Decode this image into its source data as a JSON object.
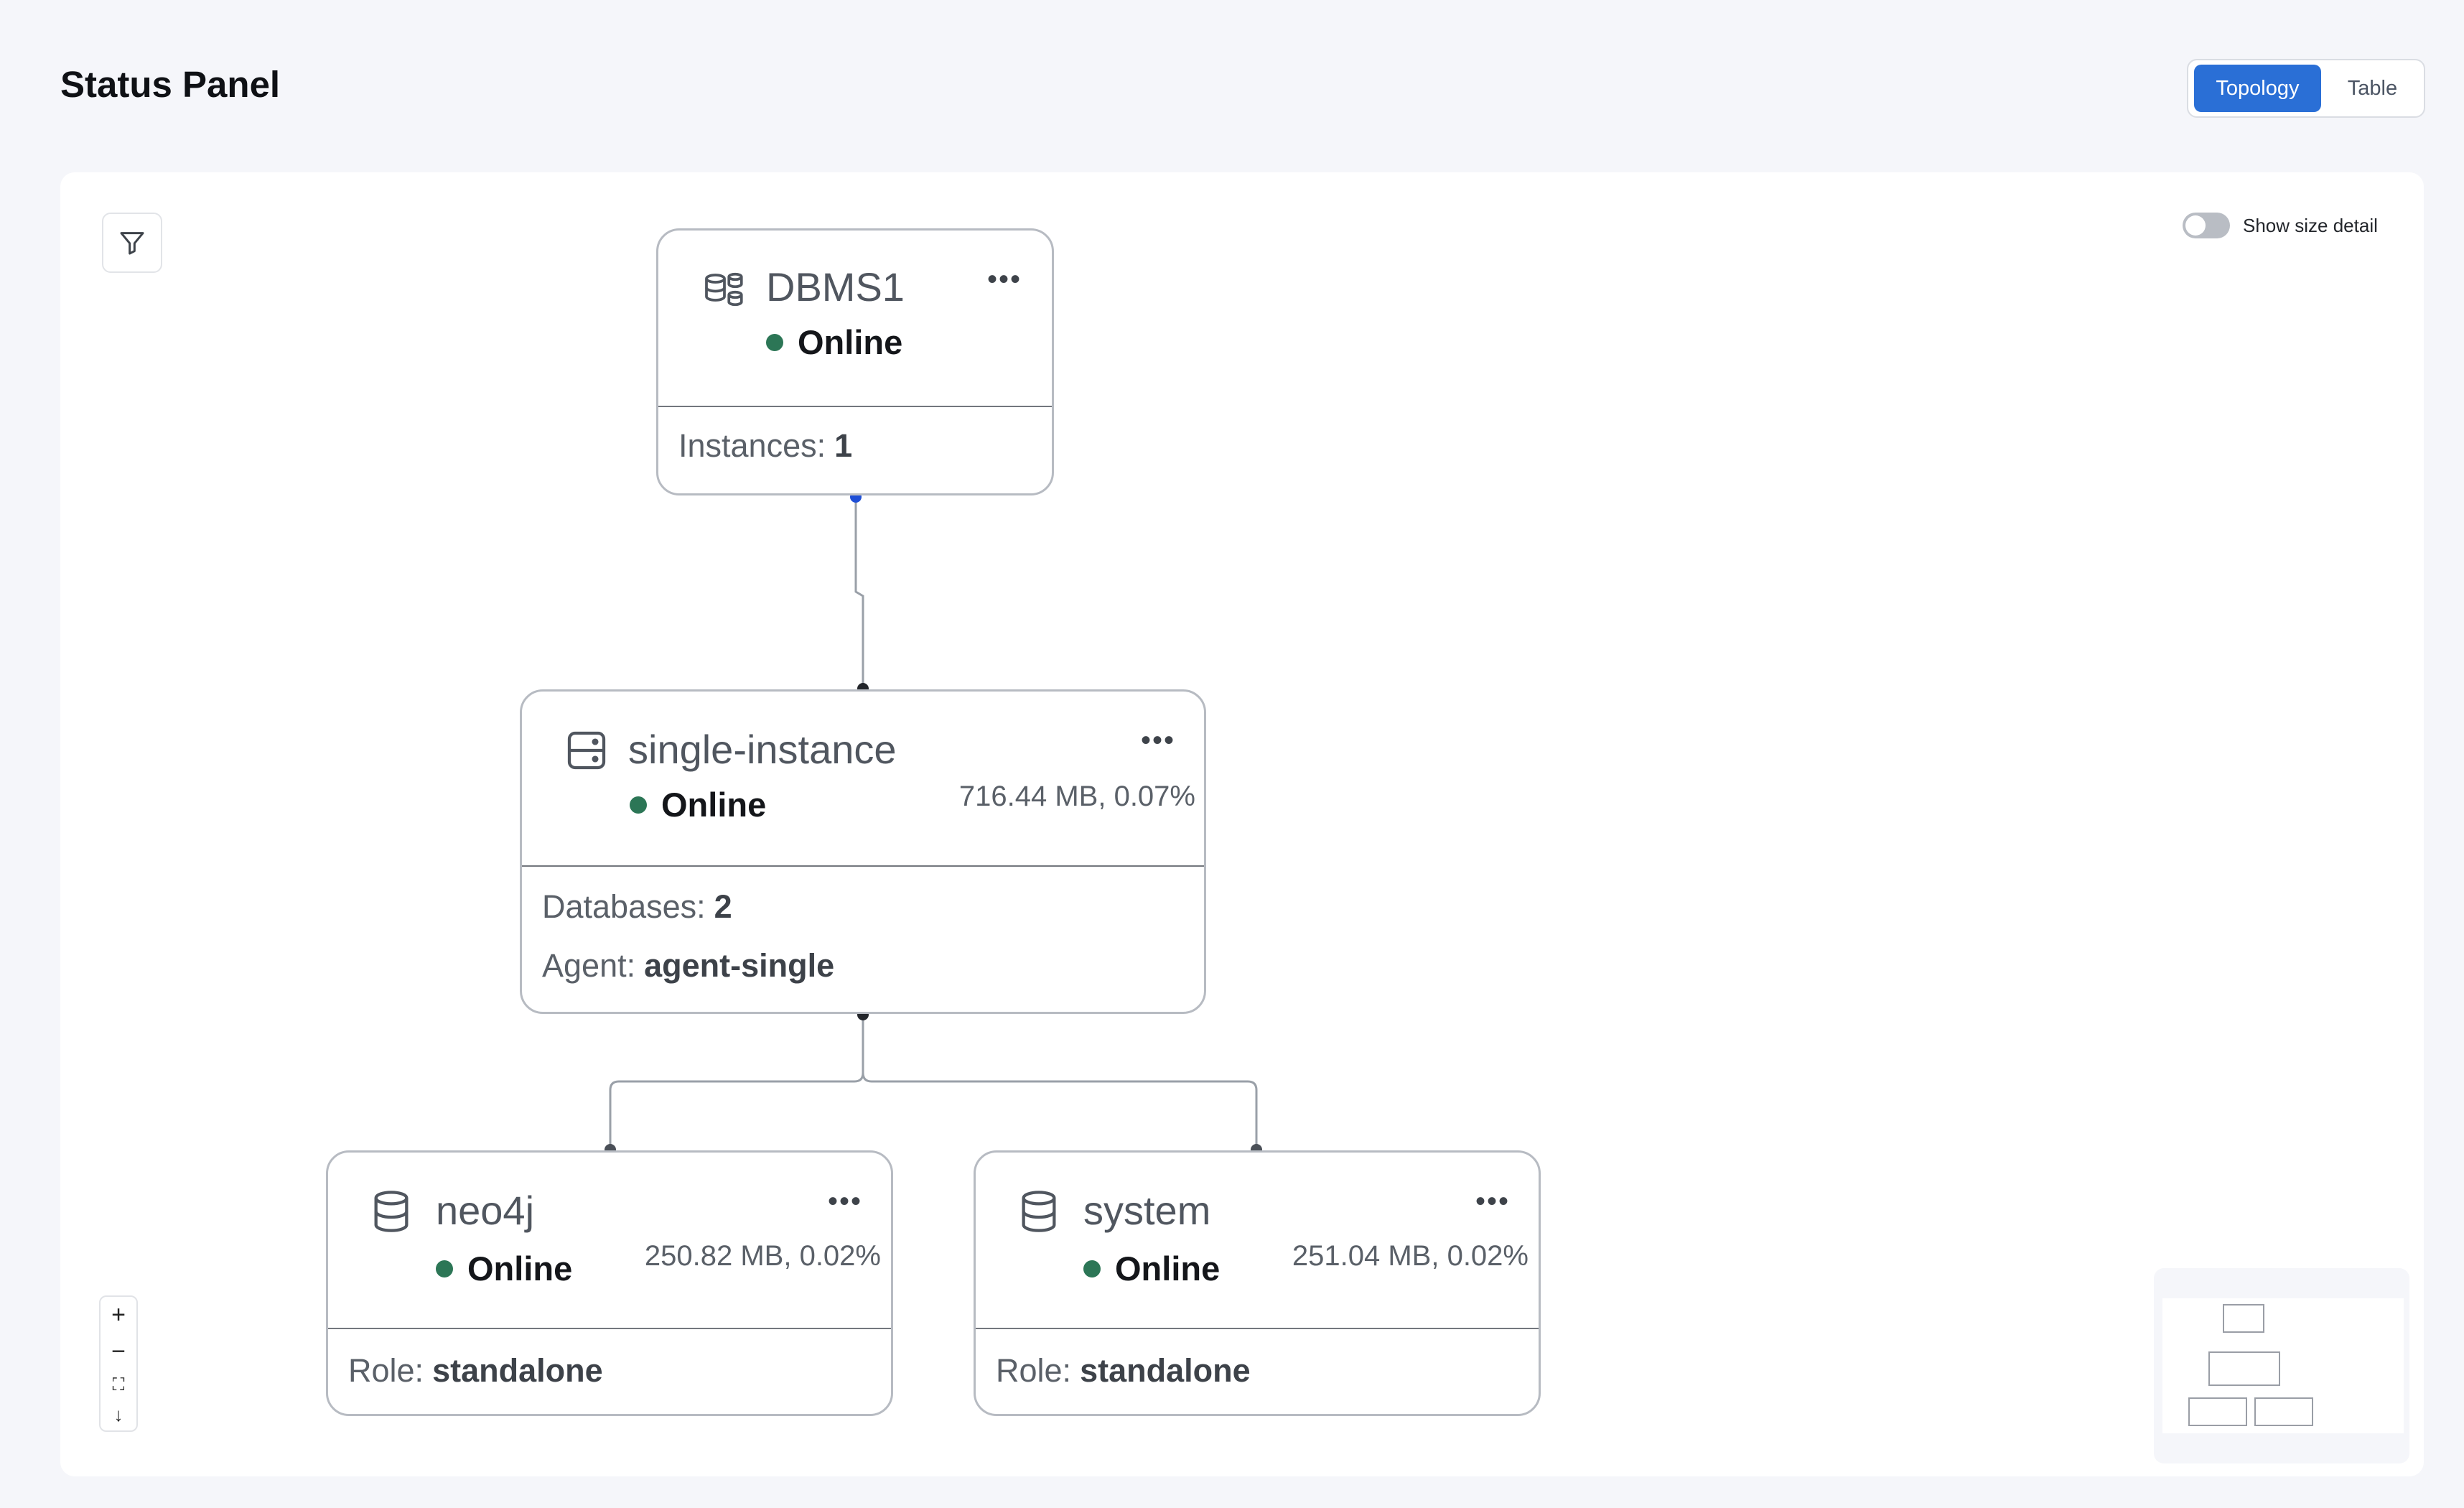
{
  "header": {
    "title": "Status Panel"
  },
  "view_toggle": {
    "topology_label": "Topology",
    "table_label": "Table",
    "selected": "Topology"
  },
  "toolbar": {
    "show_size_detail_label": "Show size detail",
    "show_size_detail_on": false
  },
  "nodes": {
    "dbms": {
      "title": "DBMS1",
      "status": "Online",
      "instances_label": "Instances:",
      "instances_value": "1",
      "icon": "database-group-icon"
    },
    "instance": {
      "title": "single-instance",
      "status": "Online",
      "size": "716.44 MB, 0.07%",
      "databases_label": "Databases:",
      "databases_value": "2",
      "agent_label": "Agent:",
      "agent_value": "agent-single",
      "icon": "server-icon"
    },
    "db_neo4j": {
      "title": "neo4j",
      "status": "Online",
      "size": "250.82 MB, 0.02%",
      "role_label": "Role:",
      "role_value": "standalone",
      "icon": "database-icon"
    },
    "db_system": {
      "title": "system",
      "status": "Online",
      "size": "251.04 MB, 0.02%",
      "role_label": "Role:",
      "role_value": "standalone",
      "icon": "database-icon"
    }
  },
  "more_label": "•••",
  "zoom_controls": {
    "zoom_in": "+",
    "zoom_out": "−",
    "fit": "⛶",
    "download": "↓"
  },
  "colors": {
    "accent": "#2a6fd6",
    "online": "#2c7656",
    "border": "#b7bbc2",
    "edge_top": "#1f4fd6"
  }
}
